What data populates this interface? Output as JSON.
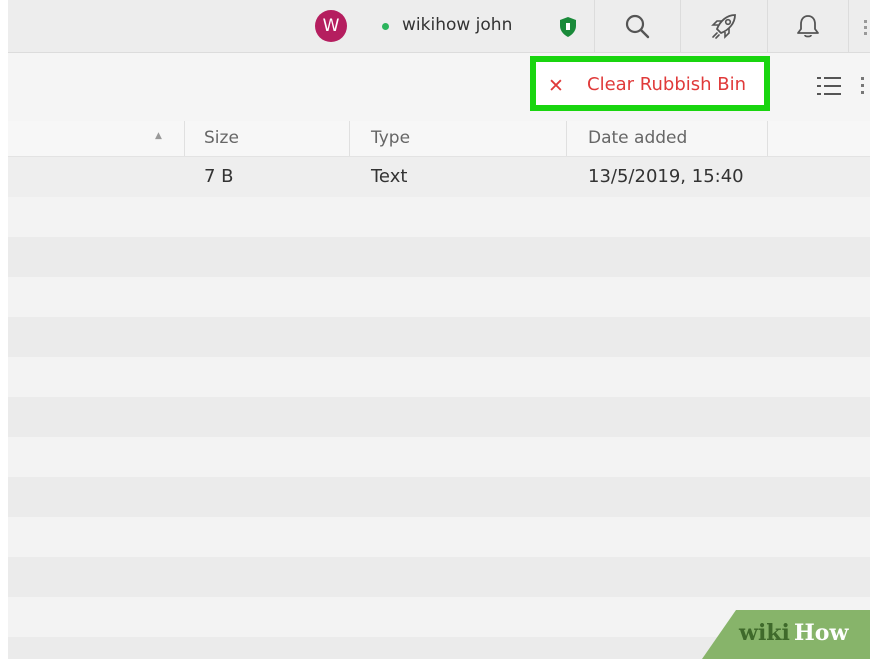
{
  "header": {
    "avatar_letter": "W",
    "user_name": "wikihow john"
  },
  "toolbar": {
    "clear_button_icon": "close-icon",
    "clear_button_label": "Clear Rubbish Bin"
  },
  "columns": [
    "Size",
    "Type",
    "Date added"
  ],
  "rows": [
    {
      "size": "7 B",
      "type": "Text",
      "date": "13/5/2019, 15:40"
    }
  ],
  "watermark": {
    "part1": "wiki",
    "part2": "How"
  },
  "colors": {
    "accent_red": "#e03a3a",
    "highlight_green": "#19d50f",
    "avatar": "#b51e5f",
    "online": "#2bb45c"
  },
  "icons": [
    "avatar",
    "status-dot",
    "shield-icon",
    "search-icon",
    "rocket-icon",
    "bell-icon",
    "more-vertical-icon",
    "list-view-icon"
  ]
}
